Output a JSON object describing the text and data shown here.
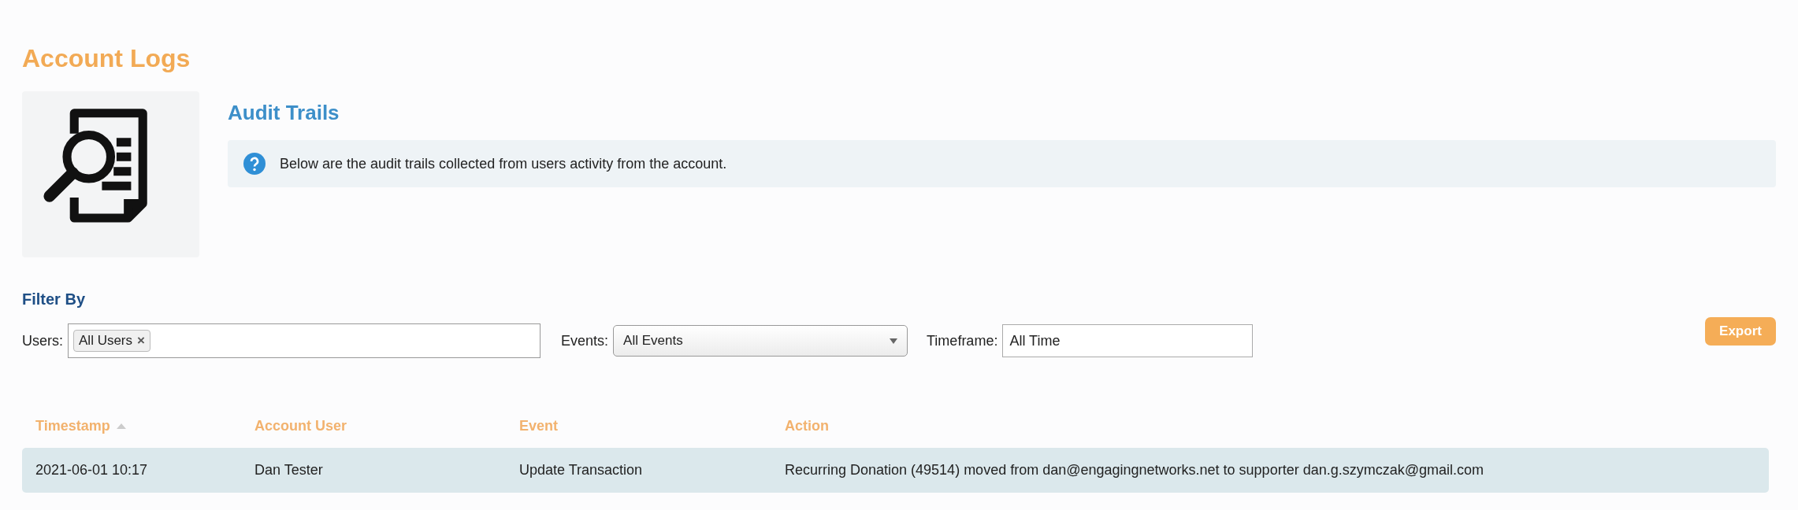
{
  "page_title": "Account Logs",
  "section": {
    "title": "Audit Trails",
    "info": "Below are the audit trails collected from users activity from the account."
  },
  "filter": {
    "heading": "Filter By",
    "users": {
      "label": "Users:",
      "tokens": [
        {
          "text": "All Users",
          "remove": "×"
        }
      ]
    },
    "events": {
      "label": "Events:",
      "value": "All Events"
    },
    "timeframe": {
      "label": "Timeframe:",
      "value": "All Time"
    },
    "export": "Export"
  },
  "table": {
    "columns": [
      {
        "label": "Timestamp",
        "sorted": true
      },
      {
        "label": "Account User",
        "sorted": false
      },
      {
        "label": "Event",
        "sorted": false
      },
      {
        "label": "Action",
        "sorted": false
      }
    ],
    "rows": [
      [
        "2021-06-01 10:17",
        "Dan Tester",
        "Update Transaction",
        "Recurring Donation (49514) moved from dan@engagingnetworks.net to supporter dan.g.szymczak@gmail.com"
      ]
    ]
  }
}
